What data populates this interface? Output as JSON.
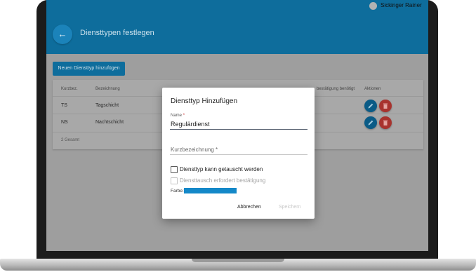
{
  "user": {
    "name": "Sickinger Rainer"
  },
  "header": {
    "title": "Diensttypen festlegen",
    "back_icon": "arrow-left-icon",
    "color": "#0e6d9c"
  },
  "toolbar": {
    "add_label": "Neuen Diensttyp hinzufügen"
  },
  "table": {
    "columns": [
      "Kurzbez.",
      "Bezeichnung",
      "bestätigung benötigt",
      "Aktionen"
    ],
    "rows": [
      {
        "short": "TS",
        "name": "Tagschicht"
      },
      {
        "short": "NS",
        "name": "Nachtschicht"
      }
    ],
    "footer": "2 Gesamt"
  },
  "dialog": {
    "title": "Diensttyp Hinzufügen",
    "name_label": "Name",
    "name_value": "Regulärdienst",
    "short_placeholder": "Kurzbezeichnung *",
    "checkbox_exchange": "Diensttyp kann getauscht werden",
    "checkbox_confirm": "Diensttausch erfordert bestätigung",
    "color_label": "Farbe:",
    "color_value": "#1488c8",
    "cancel_label": "Abbrechen",
    "save_label": "Speichern"
  }
}
